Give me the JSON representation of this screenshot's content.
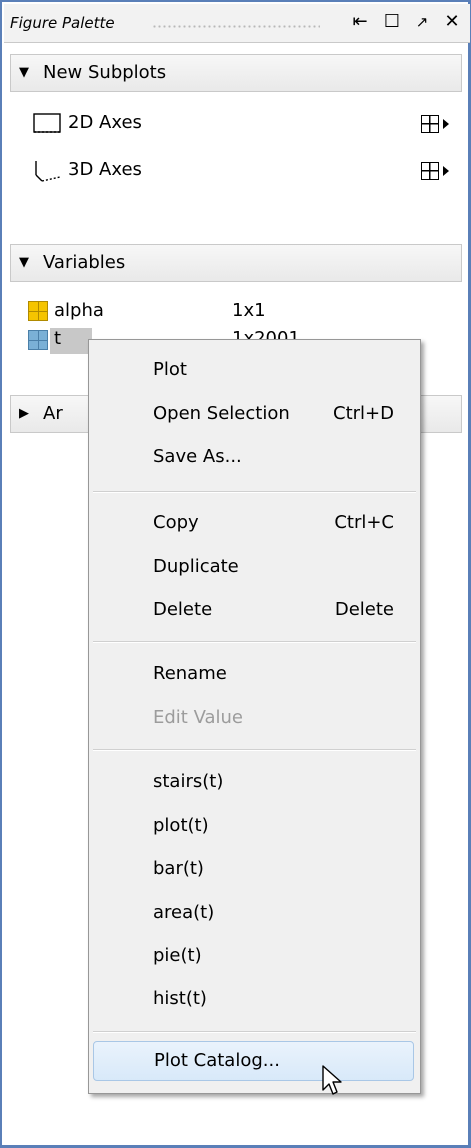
{
  "palette": {
    "title": "Figure Palette",
    "buttons": {
      "pin": "⇤",
      "maximize": "☐",
      "undock": "↗",
      "close": "✕"
    }
  },
  "new_subplots": {
    "header": "New Subplots",
    "items": [
      {
        "label": "2D Axes"
      },
      {
        "label": "3D Axes"
      }
    ]
  },
  "variables": {
    "header": "Variables",
    "items": [
      {
        "name": "alpha",
        "size": "1x1"
      },
      {
        "name": "t",
        "size": "1x2001"
      }
    ]
  },
  "annotations": {
    "header": "Ar"
  },
  "context_menu": {
    "group1": [
      {
        "label": "Plot",
        "shortcut": ""
      },
      {
        "label": "Open Selection",
        "shortcut": "Ctrl+D"
      },
      {
        "label": "Save As...",
        "shortcut": ""
      }
    ],
    "group2": [
      {
        "label": "Copy",
        "shortcut": "Ctrl+C"
      },
      {
        "label": "Duplicate",
        "shortcut": ""
      },
      {
        "label": "Delete",
        "shortcut": "Delete"
      }
    ],
    "group3": [
      {
        "label": "Rename",
        "disabled": false
      },
      {
        "label": "Edit Value",
        "disabled": true
      }
    ],
    "group4": [
      {
        "label": "stairs(t)"
      },
      {
        "label": "plot(t)"
      },
      {
        "label": "bar(t)"
      },
      {
        "label": "area(t)"
      },
      {
        "label": "pie(t)"
      },
      {
        "label": "hist(t)"
      }
    ],
    "catalog": {
      "label": "Plot Catalog..."
    }
  },
  "colors": {
    "frame_border": "#5a7fb8",
    "highlight_bg": "#d8e9f9",
    "highlight_border": "#a9c7e6",
    "alpha_icon": "#f5c400",
    "t_icon": "#7ab0d6"
  }
}
